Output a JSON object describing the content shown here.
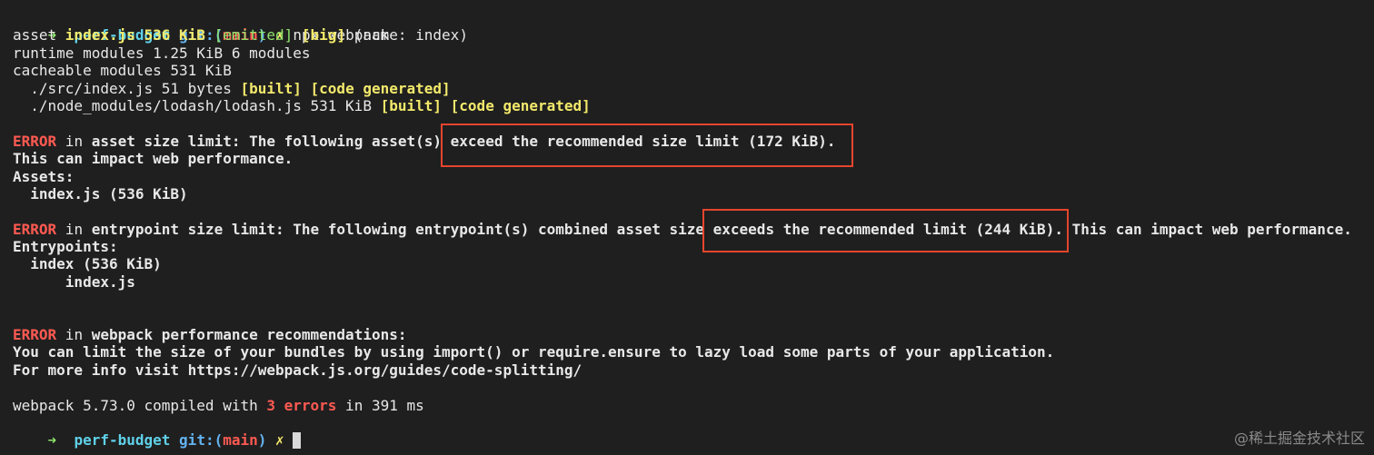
{
  "prompt": {
    "arrow": "➜",
    "directory": "perf-budget",
    "git_label": "git:",
    "paren_open": "(",
    "branch": "main",
    "paren_close": ")",
    "dirty_mark": "✗",
    "command": "npx webpack"
  },
  "asset_line": {
    "prefix": "asset ",
    "name_size": "index.js 536 KiB",
    "emitted": "[emitted]",
    "big": "[big]",
    "suffix": "(name: index)"
  },
  "runtime_line": "runtime modules 1.25 KiB 6 modules",
  "cacheable_line": "cacheable modules 531 KiB",
  "module_lines": [
    {
      "text": "  ./src/index.js 51 bytes ",
      "built": "[built]",
      "generated": "[code generated]"
    },
    {
      "text": "  ./node_modules/lodash/lodash.js 531 KiB ",
      "built": "[built]",
      "generated": "[code generated]"
    }
  ],
  "error1": {
    "label": "ERROR",
    "in": " in ",
    "title": "asset size limit",
    "message": ": The following asset(s) ",
    "highlight": "exceed the recommended size limit (172 KiB).",
    "line2": "This can impact web performance.",
    "line3": "Assets:",
    "line4": "  index.js (536 KiB)"
  },
  "error2": {
    "label": "ERROR",
    "in": " in ",
    "title": "entrypoint size limit",
    "message": ": The following entrypoint(s) combined asset size ",
    "highlight": "exceeds the recommended limit (244 KiB).",
    "message_tail": " This can impact web performance.",
    "line2": "Entrypoints:",
    "line3": "  index (536 KiB)",
    "line4": "      index.js"
  },
  "error3": {
    "label": "ERROR",
    "in": " in ",
    "title": "webpack performance recommendations",
    "colon": ":",
    "line2": "You can limit the size of your bundles by using import() or require.ensure to lazy load some parts of your application.",
    "line3": "For more info visit https://webpack.js.org/guides/code-splitting/"
  },
  "summary": {
    "prefix": "webpack 5.73.0 compiled with ",
    "errors": "3 errors",
    "suffix": " in 391 ms"
  },
  "watermark": "@稀土掘金技术社区",
  "colors": {
    "background": "#1f1f1f",
    "highlight_box": "#e5452e",
    "error": "#ff5a52",
    "warning_tag": "#f2e96b"
  }
}
